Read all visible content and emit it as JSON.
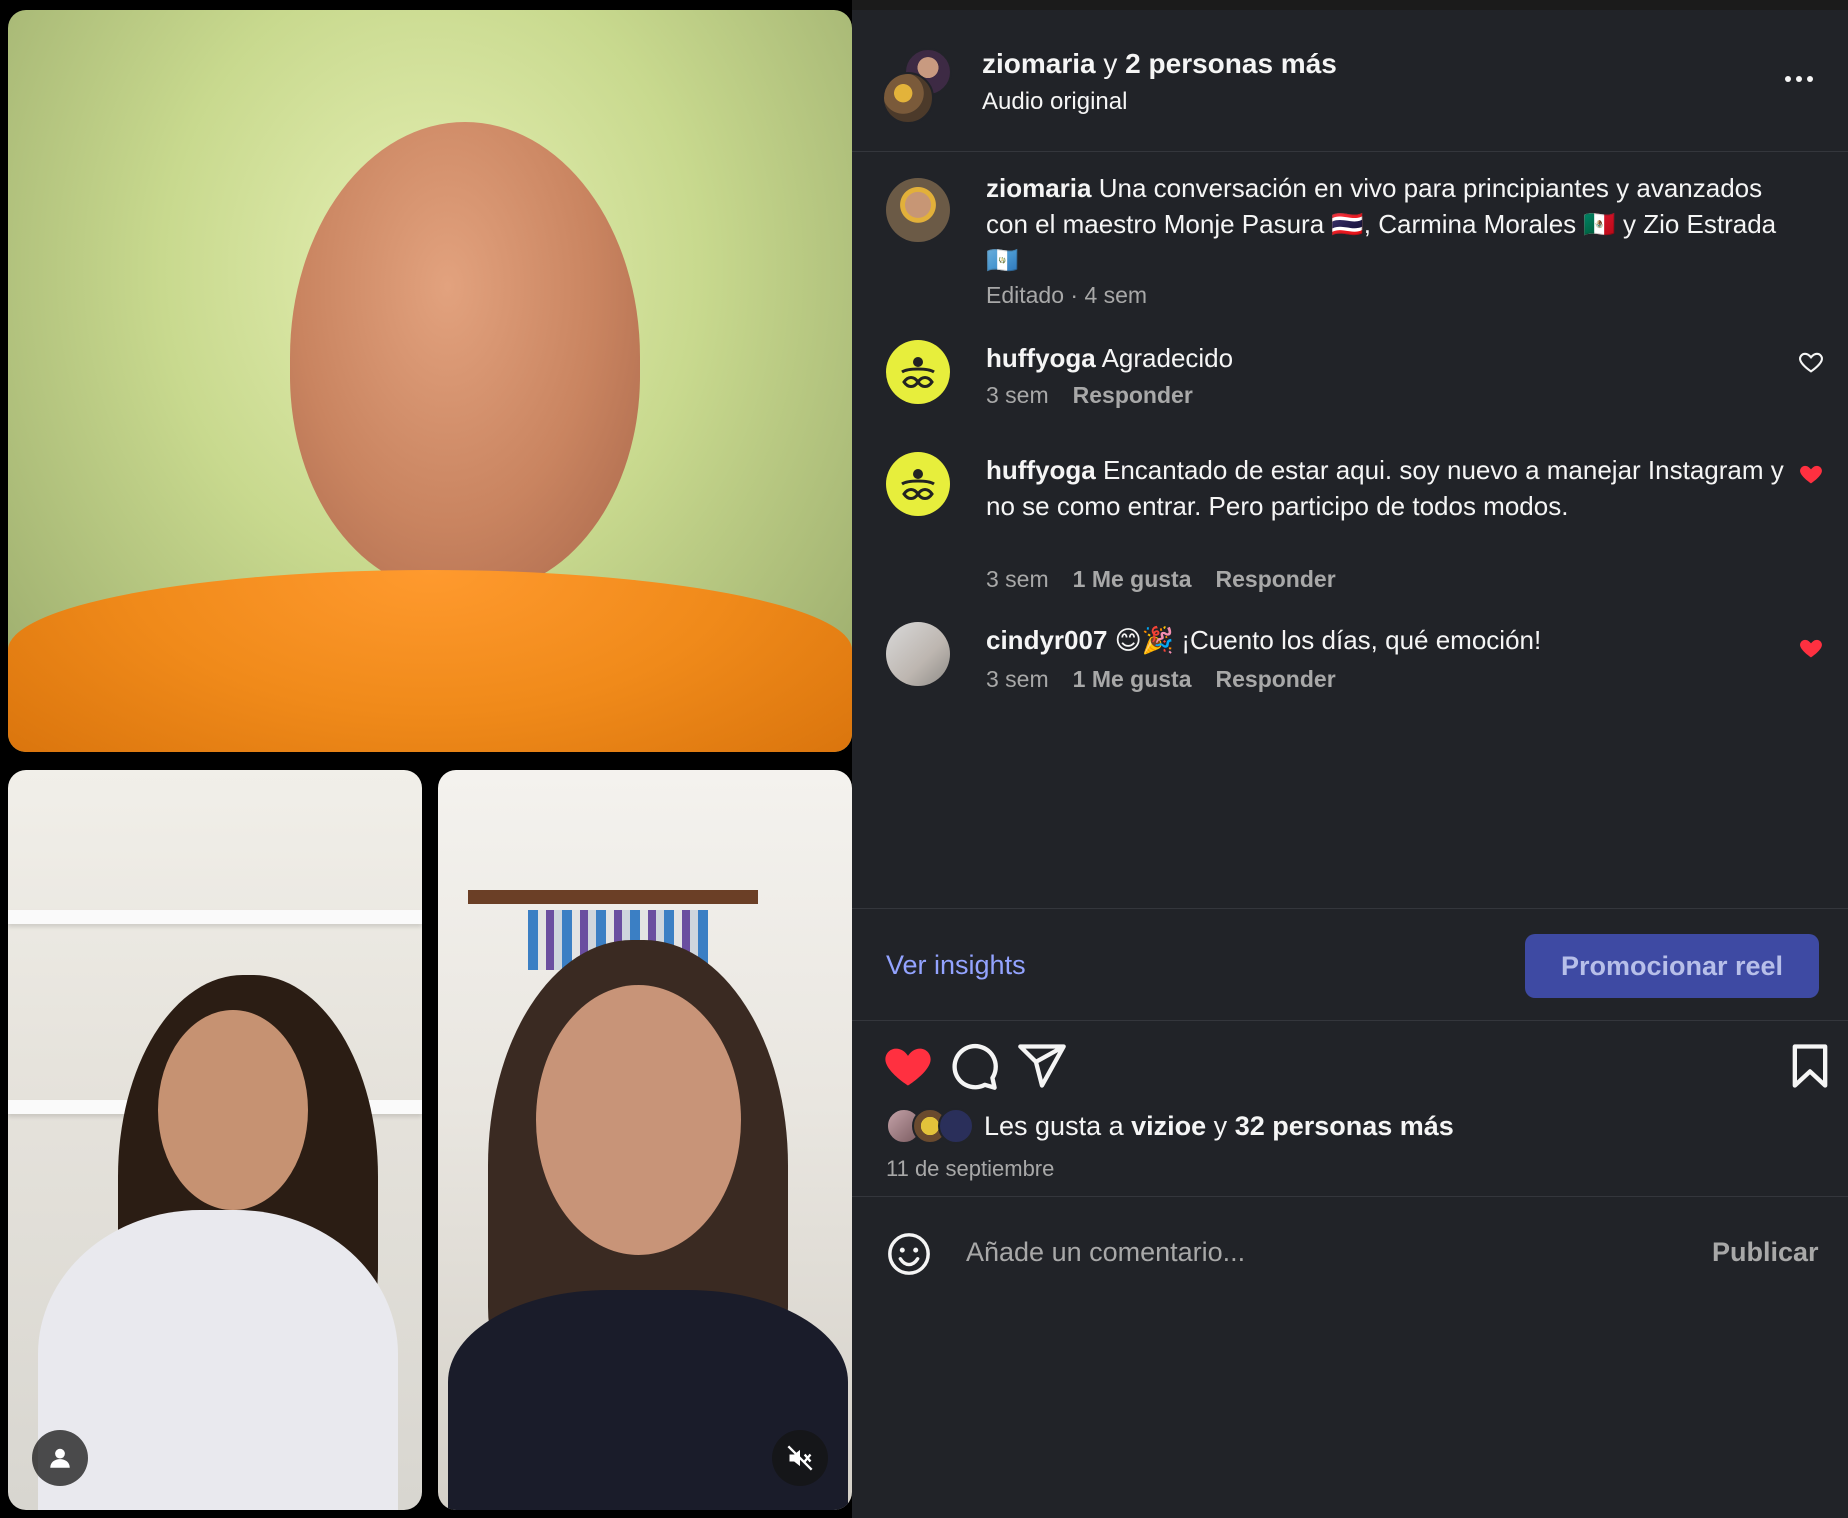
{
  "post": {
    "authors_user": "ziomaria",
    "authors_conj": "y",
    "authors_rest": "2 personas más",
    "audio": "Audio original"
  },
  "caption": {
    "user": "ziomaria",
    "text": "Una conversación en vivo para principiantes y avanzados con el maestro Monje Pasura 🇹🇭, Carmina Morales 🇲🇽 y Zio Estrada 🇬🇹",
    "edited": "Editado · 4 sem"
  },
  "comments": [
    {
      "user": "huffyoga",
      "text": "Agradecido",
      "time": "3 sem",
      "likes": "",
      "reply": "Responder",
      "liked": false
    },
    {
      "user": "huffyoga",
      "text": "Encantado de estar aqui. soy nuevo a manejar Instagram y no se como entrar. Pero participo de todos modos.",
      "time": "3 sem",
      "likes": "1 Me gusta",
      "reply": "Responder",
      "liked": true
    },
    {
      "user": "cindyr007",
      "text": "😊🎉 ¡Cuento los días, qué emoción!",
      "time": "3 sem",
      "likes": "1 Me gusta",
      "reply": "Responder",
      "liked": true
    }
  ],
  "actions": {
    "insights": "Ver insights",
    "promote": "Promocionar reel"
  },
  "likes": {
    "prefix": "Les gusta a",
    "user": "vizioe",
    "conj": "y",
    "rest": "32 personas más",
    "date": "11 de septiembre"
  },
  "composer": {
    "placeholder": "Añade un comentario...",
    "publish": "Publicar"
  },
  "icons": {
    "more": "more-horizontal-icon",
    "heart_filled": "heart-filled-icon",
    "comment": "comment-bubble-icon",
    "share": "paper-plane-icon",
    "save": "bookmark-icon",
    "emoji": "smiley-icon",
    "profile": "person-icon",
    "mute": "speaker-muted-icon"
  },
  "colors": {
    "panel_bg": "#212328",
    "like_red": "#ff3040",
    "link_blue": "#93a3ff",
    "promo_bg": "#3e4aa3"
  }
}
